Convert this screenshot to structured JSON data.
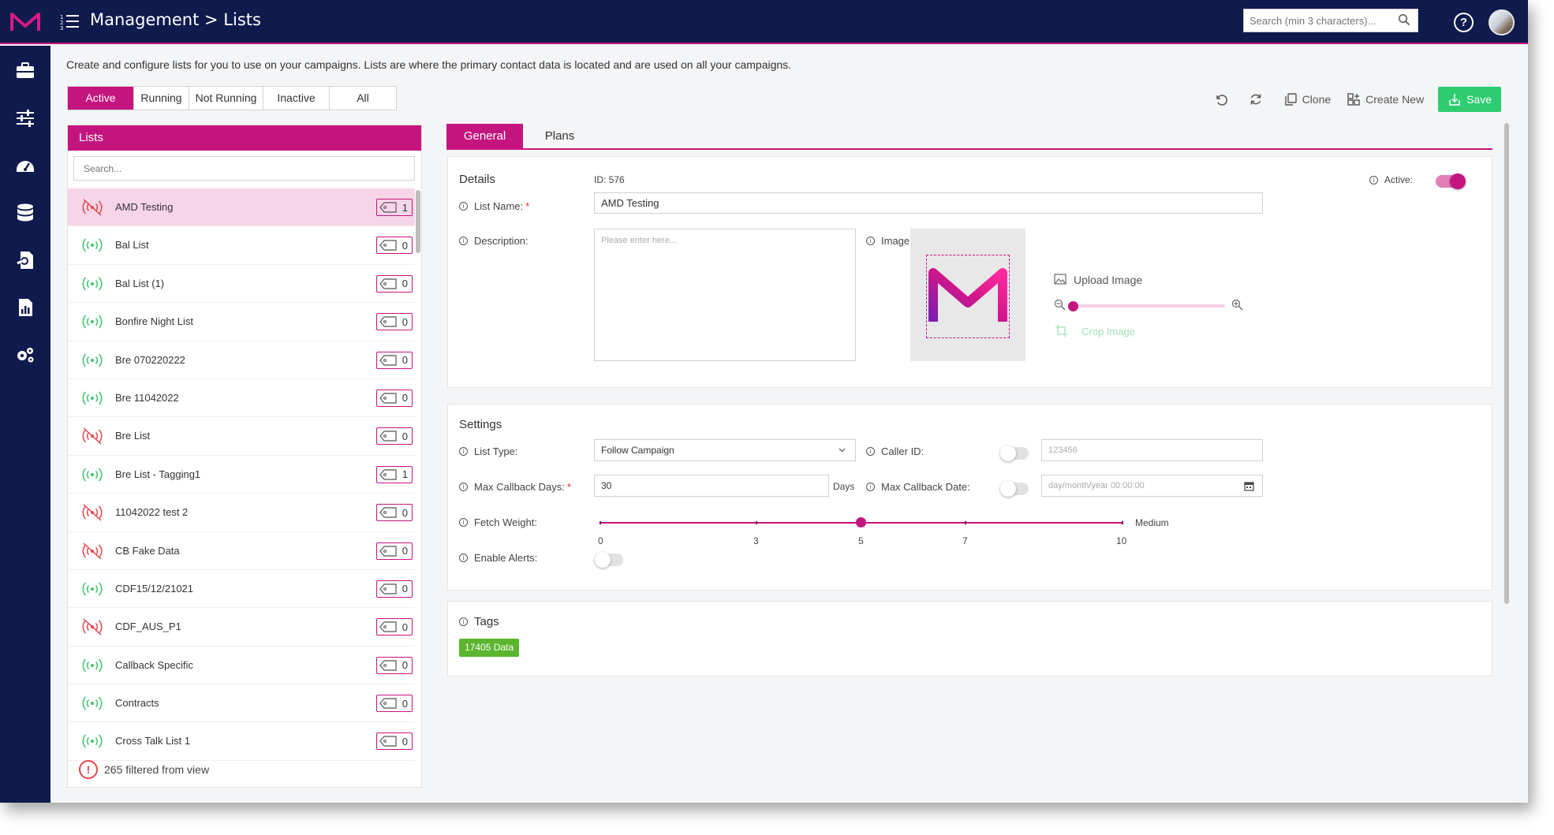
{
  "header": {
    "breadcrumb": "Management > Lists",
    "search_placeholder": "Search (min 3 characters)..."
  },
  "intro_text": "Create and configure lists for you to use on your campaigns. Lists are where the primary contact data is located and are used on all your campaigns.",
  "filter_tabs": [
    "Active",
    "Running",
    "Not Running",
    "Inactive",
    "All"
  ],
  "active_filter": "Active",
  "toolbar": {
    "clone_label": "Clone",
    "create_label": "Create New",
    "save_label": "Save"
  },
  "lists_panel": {
    "title": "Lists",
    "search_placeholder": "Search...",
    "filtered_note": "265 filtered from view",
    "items": [
      {
        "name": "AMD Testing",
        "status": "off",
        "count": "1",
        "selected": true
      },
      {
        "name": "Bal List",
        "status": "on",
        "count": "0"
      },
      {
        "name": "Bal List (1)",
        "status": "on",
        "count": "0"
      },
      {
        "name": "Bonfire Night List",
        "status": "on",
        "count": "0"
      },
      {
        "name": "Bre 070220222",
        "status": "on",
        "count": "0"
      },
      {
        "name": "Bre 11042022",
        "status": "on",
        "count": "0"
      },
      {
        "name": "Bre List",
        "status": "off",
        "count": "0"
      },
      {
        "name": "Bre List - Tagging1",
        "status": "on",
        "count": "1"
      },
      {
        "name": "11042022 test 2",
        "status": "off",
        "count": "0"
      },
      {
        "name": "CB Fake Data",
        "status": "off",
        "count": "0"
      },
      {
        "name": "CDF15/12/21021",
        "status": "on",
        "count": "0"
      },
      {
        "name": "CDF_AUS_P1",
        "status": "off",
        "count": "0"
      },
      {
        "name": "Callback Specific",
        "status": "on",
        "count": "0"
      },
      {
        "name": "Contracts",
        "status": "on",
        "count": "0"
      },
      {
        "name": "Cross Talk List 1",
        "status": "on",
        "count": "0"
      }
    ]
  },
  "detail_tabs": [
    "General",
    "Plans"
  ],
  "details": {
    "title": "Details",
    "id_text": "ID: 576",
    "active_label": "Active:",
    "active_on": true,
    "list_name_label": "List Name:",
    "list_name_value": "AMD Testing",
    "description_label": "Description:",
    "description_placeholder": "Please enter here...",
    "image_label": "Image:",
    "upload_label": "Upload Image",
    "crop_label": "Crop Image"
  },
  "settings": {
    "title": "Settings",
    "list_type_label": "List Type:",
    "list_type_value": "Follow Campaign",
    "caller_id_label": "Caller ID:",
    "caller_id_placeholder": "123456",
    "max_callback_days_label": "Max Callback Days:",
    "max_callback_days_value": "30",
    "days_label": "Days",
    "max_callback_date_label": "Max Callback Date:",
    "max_callback_date_placeholder": "day/month/year 00:00:00",
    "fetch_weight_label": "Fetch Weight:",
    "fetch_weight_value": 5,
    "fetch_weight_level": "Medium",
    "fetch_weight_ticks": [
      "0",
      "3",
      "5",
      "7",
      "10"
    ],
    "enable_alerts_label": "Enable Alerts:"
  },
  "tags": {
    "title": "Tags",
    "chip": "17405 Data"
  },
  "colors": {
    "brand": "#c4157e",
    "navy": "#0f1a4d",
    "save": "#2ecc71",
    "status_on": "#3cc46a",
    "status_off": "#e4474b"
  }
}
